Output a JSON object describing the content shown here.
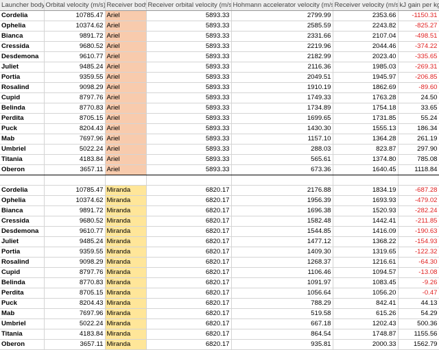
{
  "headers": [
    "Launcher body",
    "Orbital velocity (m/s)",
    "Receiver body",
    "Receiver orbital velocity (m/s)",
    "Hohmann accelerator velocity (m/s)",
    "Receiver velocity (m/s)",
    "kJ gain per kg"
  ],
  "colors": {
    "ariel_fill": "#f8cbad",
    "miranda_fill": "#ffe699",
    "negative_text": "#e02020",
    "header_fill": "#ededed"
  },
  "tables": [
    {
      "receiver": "Ariel",
      "rows": [
        [
          "Cordelia",
          "10785.47",
          "Ariel",
          "5893.33",
          "2799.99",
          "2353.66",
          "-1150.31"
        ],
        [
          "Ophelia",
          "10374.62",
          "Ariel",
          "5893.33",
          "2585.59",
          "2243.82",
          "-825.27"
        ],
        [
          "Bianca",
          "9891.72",
          "Ariel",
          "5893.33",
          "2331.66",
          "2107.04",
          "-498.51"
        ],
        [
          "Cressida",
          "9680.52",
          "Ariel",
          "5893.33",
          "2219.96",
          "2044.46",
          "-374.22"
        ],
        [
          "Desdemona",
          "9610.77",
          "Ariel",
          "5893.33",
          "2182.99",
          "2023.40",
          "-335.65"
        ],
        [
          "Juliet",
          "9485.24",
          "Ariel",
          "5893.33",
          "2116.36",
          "1985.03",
          "-269.31"
        ],
        [
          "Portia",
          "9359.55",
          "Ariel",
          "5893.33",
          "2049.51",
          "1945.97",
          "-206.85"
        ],
        [
          "Rosalind",
          "9098.29",
          "Ariel",
          "5893.33",
          "1910.19",
          "1862.69",
          "-89.60"
        ],
        [
          "Cupid",
          "8797.76",
          "Ariel",
          "5893.33",
          "1749.33",
          "1763.28",
          "24.50"
        ],
        [
          "Belinda",
          "8770.83",
          "Ariel",
          "5893.33",
          "1734.89",
          "1754.18",
          "33.65"
        ],
        [
          "Perdita",
          "8705.15",
          "Ariel",
          "5893.33",
          "1699.65",
          "1731.85",
          "55.24"
        ],
        [
          "Puck",
          "8204.43",
          "Ariel",
          "5893.33",
          "1430.30",
          "1555.13",
          "186.34"
        ],
        [
          "Mab",
          "7697.96",
          "Ariel",
          "5893.33",
          "1157.10",
          "1364.28",
          "261.19"
        ],
        [
          "Umbriel",
          "5022.24",
          "Ariel",
          "5893.33",
          "288.03",
          "823.87",
          "297.90"
        ],
        [
          "Titania",
          "4183.84",
          "Ariel",
          "5893.33",
          "565.61",
          "1374.80",
          "785.08"
        ],
        [
          "Oberon",
          "3657.11",
          "Ariel",
          "5893.33",
          "673.36",
          "1640.45",
          "1118.84"
        ]
      ]
    },
    {
      "receiver": "Miranda",
      "rows": [
        [
          "Cordelia",
          "10785.47",
          "Miranda",
          "6820.17",
          "2176.88",
          "1834.19",
          "-687.28"
        ],
        [
          "Ophelia",
          "10374.62",
          "Miranda",
          "6820.17",
          "1956.39",
          "1693.93",
          "-479.02"
        ],
        [
          "Bianca",
          "9891.72",
          "Miranda",
          "6820.17",
          "1696.38",
          "1520.93",
          "-282.24"
        ],
        [
          "Cressida",
          "9680.52",
          "Miranda",
          "6820.17",
          "1582.48",
          "1442.41",
          "-211.85"
        ],
        [
          "Desdemona",
          "9610.77",
          "Miranda",
          "6820.17",
          "1544.85",
          "1416.09",
          "-190.63"
        ],
        [
          "Juliet",
          "9485.24",
          "Miranda",
          "6820.17",
          "1477.12",
          "1368.22",
          "-154.93"
        ],
        [
          "Portia",
          "9359.55",
          "Miranda",
          "6820.17",
          "1409.30",
          "1319.65",
          "-122.32"
        ],
        [
          "Rosalind",
          "9098.29",
          "Miranda",
          "6820.17",
          "1268.37",
          "1216.61",
          "-64.30"
        ],
        [
          "Cupid",
          "8797.76",
          "Miranda",
          "6820.17",
          "1106.46",
          "1094.57",
          "-13.08"
        ],
        [
          "Belinda",
          "8770.83",
          "Miranda",
          "6820.17",
          "1091.97",
          "1083.45",
          "-9.26"
        ],
        [
          "Perdita",
          "8705.15",
          "Miranda",
          "6820.17",
          "1056.64",
          "1056.20",
          "-0.47"
        ],
        [
          "Puck",
          "8204.43",
          "Miranda",
          "6820.17",
          "788.29",
          "842.41",
          "44.13"
        ],
        [
          "Mab",
          "7697.96",
          "Miranda",
          "6820.17",
          "519.58",
          "615.26",
          "54.29"
        ],
        [
          "Umbriel",
          "5022.24",
          "Miranda",
          "6820.17",
          "667.18",
          "1202.43",
          "500.36"
        ],
        [
          "Titania",
          "4183.84",
          "Miranda",
          "6820.17",
          "864.54",
          "1748.87",
          "1155.56"
        ],
        [
          "Oberon",
          "3657.11",
          "Miranda",
          "6820.17",
          "935.81",
          "2000.33",
          "1562.79"
        ]
      ]
    }
  ]
}
